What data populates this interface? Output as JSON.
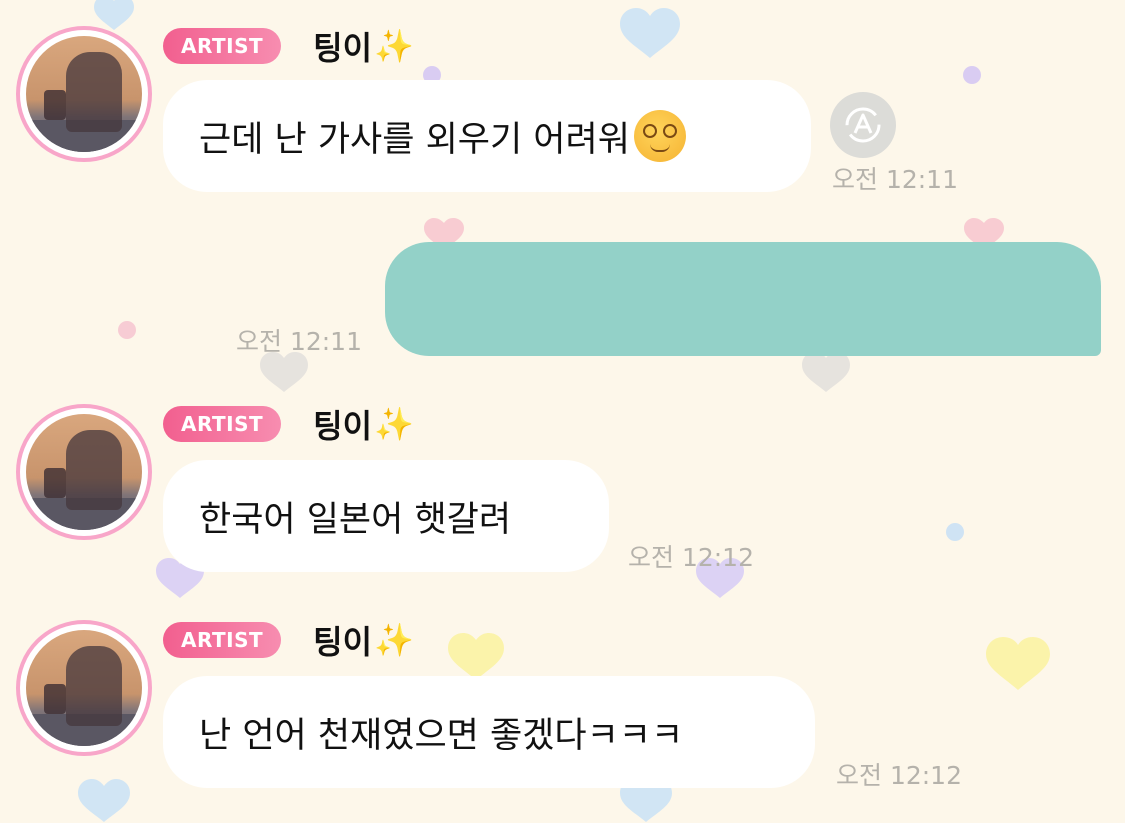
{
  "messages": [
    {
      "badge": "ARTIST",
      "sender": "팅이",
      "text": "근데 난 가사를 외우기 어려워",
      "time": "오전 12:11",
      "emoji": "dizzy-face"
    },
    {
      "sent": true,
      "time": "오전 12:11"
    },
    {
      "badge": "ARTIST",
      "sender": "팅이",
      "text": "한국어 일본어 햇갈려",
      "time": "오전 12:12"
    },
    {
      "badge": "ARTIST",
      "sender": "팅이",
      "text": "난 언어 천재였으면 좋겠다ㅋㅋㅋ",
      "time": "오전 12:12"
    }
  ],
  "icons": {
    "sparkle": "✨",
    "translate": "translate-icon",
    "sparkle_name": "sparkles-icon"
  },
  "colors": {
    "background": "#fdf7ea",
    "badge": "#f25f8f",
    "avatar_ring": "#f8a6c9",
    "sent_bubble": "#93d1c8",
    "time_text": "#b5b2ab"
  }
}
